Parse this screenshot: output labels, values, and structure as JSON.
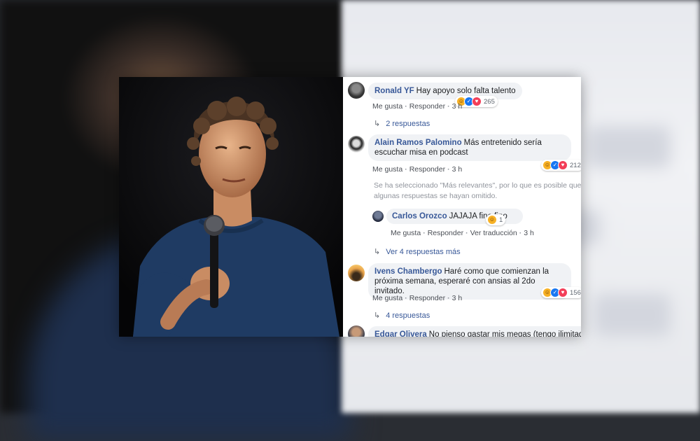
{
  "comments": [
    {
      "author": "Ronald YF",
      "text": "Hay apoyo solo falta talento",
      "like": "Me gusta",
      "reply": "Responder",
      "time": "3 h",
      "reactions": {
        "icons": [
          "haha-icon",
          "like-icon",
          "love-icon"
        ],
        "count": "265"
      },
      "replies_link": "2 respuestas"
    },
    {
      "author": "Alain Ramos Palomino",
      "text": "Más entretenido sería escuchar misa en podcast",
      "like": "Me gusta",
      "reply": "Responder",
      "time": "3 h",
      "reactions": {
        "icons": [
          "haha-icon",
          "like-icon",
          "love-icon"
        ],
        "count": "212"
      },
      "note": "Se ha seleccionado \"Más relevantes\", por lo que es posible que algunas respuestas se hayan omitido.",
      "reply_item": {
        "author": "Carlos Orozco",
        "text": "JAJAJA fino fino",
        "like": "Me gusta",
        "reply": "Responder",
        "translate": "Ver traducción",
        "time": "3 h",
        "reactions": {
          "icons": [
            "haha-icon"
          ],
          "count": "1"
        }
      },
      "replies_link": "Ver 4 respuestas más"
    },
    {
      "author": "Ivens Chambergo",
      "text": "Haré como que comienzan la próxima semana, esperaré con ansias al 2do invitado.",
      "like": "Me gusta",
      "reply": "Responder",
      "time": "3 h",
      "reactions": {
        "icons": [
          "haha-icon",
          "like-icon",
          "love-icon"
        ],
        "count": "156"
      },
      "replies_link": "4 respuestas"
    },
    {
      "author": "Edgar Olivera",
      "text": "No pienso gastar mis megas (tengo ilimitado)"
    }
  ],
  "colors": {
    "name": "#385898",
    "bubble": "#f0f2f5",
    "muted": "#606770"
  }
}
